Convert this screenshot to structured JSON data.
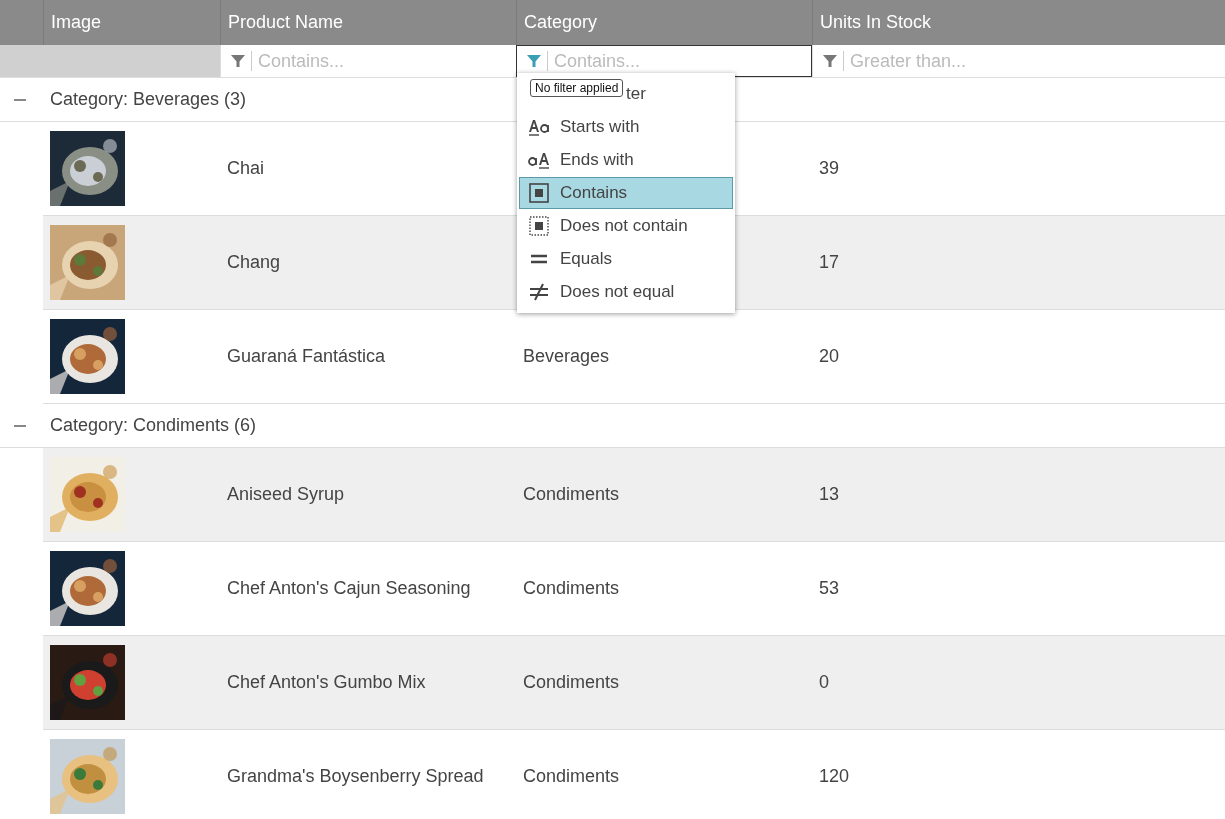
{
  "columns": [
    {
      "label": "Image"
    },
    {
      "label": "Product Name"
    },
    {
      "label": "Category"
    },
    {
      "label": "Units In Stock"
    }
  ],
  "filters": [
    {
      "placeholder": "Contains...",
      "focused": false
    },
    {
      "placeholder": "Contains...",
      "focused": true
    },
    {
      "placeholder": "Greater than...",
      "focused": false
    }
  ],
  "groups": [
    {
      "label": "Category: Beverages (3)",
      "expanded": true,
      "rows": [
        {
          "product": "Chai",
          "units": "39"
        },
        {
          "product": "Chang",
          "units": "17"
        },
        {
          "product": "Guaraná Fantástica",
          "category": "Beverages",
          "units": "20"
        }
      ]
    },
    {
      "label": "Category: Condiments (6)",
      "expanded": true,
      "rows": [
        {
          "product": "Aniseed Syrup",
          "category": "Condiments",
          "units": "13"
        },
        {
          "product": "Chef Anton's Cajun Seasoning",
          "category": "Condiments",
          "units": "53"
        },
        {
          "product": "Chef Anton's Gumbo Mix",
          "category": "Condiments",
          "units": "0"
        },
        {
          "product": "Grandma's Boysenberry Spread",
          "category": "Condiments",
          "units": "120"
        }
      ]
    }
  ],
  "filter_menu": {
    "items": [
      {
        "label": "ter",
        "covered": true,
        "selected": false
      },
      {
        "label": "Starts with",
        "covered": false,
        "selected": false
      },
      {
        "label": "Ends with",
        "covered": false,
        "selected": false
      },
      {
        "label": "Contains",
        "covered": false,
        "selected": true
      },
      {
        "label": "Does not contain",
        "covered": false,
        "selected": false
      },
      {
        "label": "Equals",
        "covered": false,
        "selected": false
      },
      {
        "label": "Does not equal",
        "covered": false,
        "selected": false
      }
    ]
  },
  "tooltip": "No filter applied"
}
